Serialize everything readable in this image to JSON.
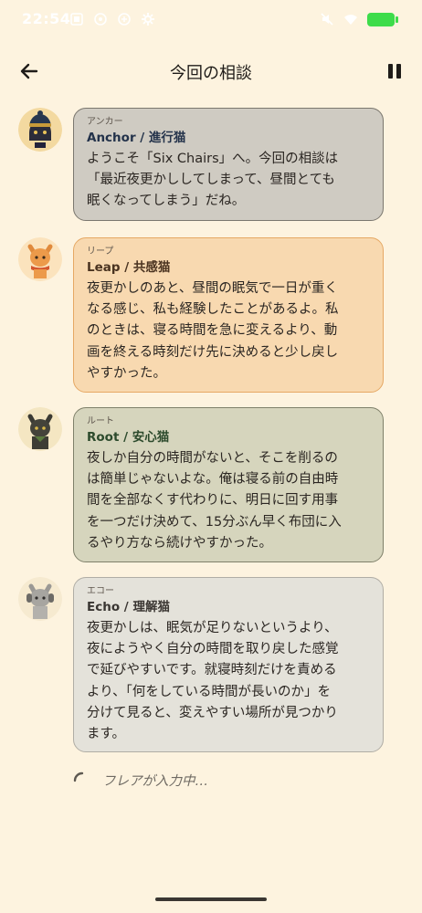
{
  "status_bar": {
    "time": "22:54"
  },
  "header": {
    "title": "今回の相談"
  },
  "messages": [
    {
      "kana": "アンカー",
      "name": "Anchor / 進行猫",
      "lines": [
        "ようこそ「Six Chairs」へ。今回の相談は",
        "「最近夜更かししてしまって、昼間とても",
        "眠くなってしまう」だね。"
      ]
    },
    {
      "kana": "リープ",
      "name": "Leap / 共感猫",
      "lines": [
        "夜更かしのあと、昼間の眠気で一日が重く",
        "なる感じ、私も経験したことがあるよ。私",
        "のときは、寝る時間を急に変えるより、動",
        "画を終える時刻だけ先に決めると少し戻し",
        "やすかった。"
      ]
    },
    {
      "kana": "ルート",
      "name": "Root / 安心猫",
      "lines": [
        "夜しか自分の時間がないと、そこを削るの",
        "は簡単じゃないよな。俺は寝る前の自由時",
        "間を全部なくす代わりに、明日に回す用事",
        "を一つだけ決めて、15分ぶん早く布団に入",
        "るやり方なら続けやすかった。"
      ]
    },
    {
      "kana": "エコー",
      "name": "Echo / 理解猫",
      "lines": [
        "夜更かしは、眠気が足りないというより、",
        "夜にようやく自分の時間を取り戻した感覚",
        "で延びやすいです。就寝時刻だけを責める",
        "より、「何をしている時間が長いのか」を",
        "分けて見ると、変えやすい場所が見つかり",
        "ます。"
      ]
    }
  ],
  "typing": {
    "text": "フレアが入力中…"
  },
  "icons": {
    "back": "arrow-back-icon",
    "pause": "pause-icon",
    "spinner": "loading-spinner-icon"
  }
}
